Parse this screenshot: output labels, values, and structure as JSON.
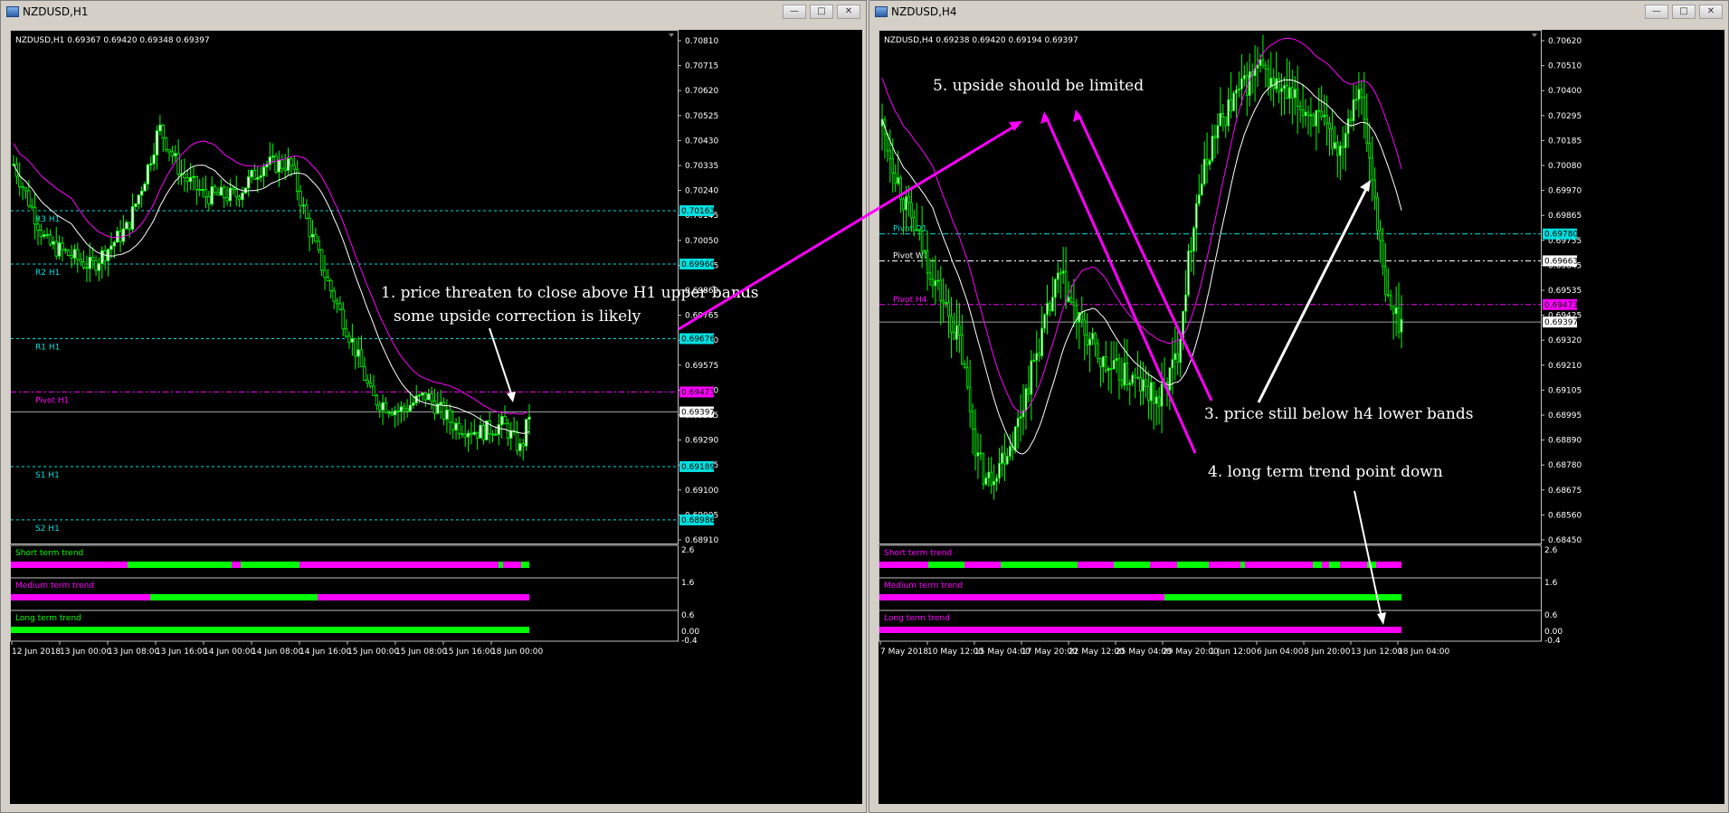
{
  "left_window": {
    "title": "NZDUSD,H1",
    "ohlc_header": "NZDUSD,H1  0.69367 0.69420 0.69348 0.69397",
    "price_scale": [
      "0.70810",
      "0.70715",
      "0.70620",
      "0.70525",
      "0.70430",
      "0.70335",
      "0.70240",
      "0.70145",
      "0.70050",
      "0.69955",
      "0.69860",
      "0.69765",
      "0.69670",
      "0.69575",
      "0.69480",
      "0.69385",
      "0.69290",
      "0.69195",
      "0.69100",
      "0.69005",
      "0.68910"
    ],
    "levels": [
      {
        "name": "R3 H1",
        "price": "0.70163",
        "color": "#00e0e0"
      },
      {
        "name": "R2 H1",
        "price": "0.69960",
        "color": "#00e0e0"
      },
      {
        "name": "R1 H1",
        "price": "0.69676",
        "color": "#00e0e0"
      },
      {
        "name": "Pivot H1",
        "price": "0.69473",
        "color": "#ff00ff"
      },
      {
        "name": "S1 H1",
        "price": "0.69189",
        "color": "#00e0e0"
      },
      {
        "name": "S2 H1",
        "price": "0.68986",
        "color": "#00e0e0"
      }
    ],
    "current_price": "0.69397",
    "time_axis": [
      "12 Jun 2018",
      "13 Jun 00:00",
      "13 Jun 08:00",
      "13 Jun 16:00",
      "14 Jun 00:00",
      "14 Jun 08:00",
      "14 Jun 16:00",
      "15 Jun 00:00",
      "15 Jun 08:00",
      "15 Jun 16:00",
      "18 Jun 00:00"
    ],
    "trend_panels": [
      {
        "label": "Short term trend",
        "color": "#00ff00",
        "scale": "2.6"
      },
      {
        "label": "Medium term trend",
        "color": "#ff00ff",
        "scale": "1.6"
      },
      {
        "label": "Long term trend",
        "color": "#00ff00",
        "scale": "0.6"
      }
    ],
    "bottom_scale": [
      "0.00",
      "-0.4"
    ],
    "annotations": [
      "1. price threaten to close above H1 upper bands",
      "some upside correction is likely"
    ]
  },
  "right_window": {
    "title": "NZDUSD,H4",
    "ohlc_header": "NZDUSD,H4  0.69238 0.69420 0.69194 0.69397",
    "price_scale": [
      "0.70620",
      "0.70510",
      "0.70400",
      "0.70295",
      "0.70185",
      "0.70080",
      "0.69970",
      "0.69865",
      "0.69755",
      "0.69645",
      "0.69535",
      "0.69425",
      "0.69320",
      "0.69210",
      "0.69105",
      "0.68995",
      "0.68890",
      "0.68780",
      "0.68675",
      "0.68560",
      "0.68450"
    ],
    "levels": [
      {
        "name": "Pivot D1",
        "price": "0.69780",
        "color": "#00e0e0"
      },
      {
        "name": "Pivot W1",
        "price": "0.69663",
        "color": "#ffffff"
      },
      {
        "name": "Pivot H4",
        "price": "0.69473",
        "color": "#ff00ff"
      }
    ],
    "current_price": "0.69397",
    "time_axis": [
      "7 May 2018",
      "10 May 12:00",
      "15 May 04:00",
      "17 May 20:00",
      "22 May 12:00",
      "25 May 04:00",
      "29 May 20:00",
      "1 Jun 12:00",
      "6 Jun 04:00",
      "8 Jun 20:00",
      "13 Jun 12:00",
      "18 Jun 04:00"
    ],
    "trend_panels": [
      {
        "label": "Short term trend",
        "color": "#ff00ff",
        "scale": "2.6"
      },
      {
        "label": "Medium term trend",
        "color": "#ff00ff",
        "scale": "1.6"
      },
      {
        "label": "Long term trend",
        "color": "#ff00ff",
        "scale": "0.6"
      }
    ],
    "bottom_scale": [
      "0.00",
      "-0.4"
    ],
    "annotations": [
      "5. upside should be limited",
      "3. price still below h4 lower bands",
      "4. long term trend point down"
    ]
  },
  "window_buttons": [
    "minimize",
    "maximize",
    "close"
  ],
  "colors": {
    "bull": "#00ff00",
    "bear": "#000000",
    "band": "#ff00ff",
    "ma": "#ffffff",
    "cyan": "#00e0e0",
    "magenta": "#ff00ff"
  }
}
